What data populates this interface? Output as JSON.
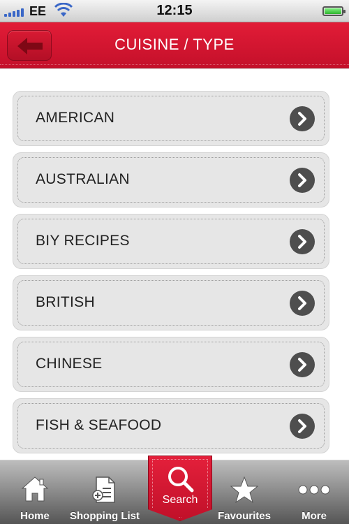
{
  "status_bar": {
    "carrier": "EE",
    "time": "12:15",
    "battery_level": 1.0,
    "signal_bars": 5,
    "icons": [
      "signal-icon",
      "wifi-icon",
      "battery-icon"
    ]
  },
  "nav": {
    "title": "CUISINE / TYPE",
    "back_icon": "back-arrow-icon"
  },
  "colors": {
    "brand_red": "#d8152f",
    "list_bg": "#e6e6e6",
    "chevron_bg": "#4e4e4e"
  },
  "list": {
    "items": [
      {
        "label": "AMERICAN"
      },
      {
        "label": "AUSTRALIAN"
      },
      {
        "label": "BIY RECIPES"
      },
      {
        "label": "BRITISH"
      },
      {
        "label": "CHINESE"
      },
      {
        "label": "FISH & SEAFOOD"
      }
    ]
  },
  "tab_bar": {
    "tabs": [
      {
        "label": "Home",
        "icon": "home-icon"
      },
      {
        "label": "Shopping List",
        "icon": "shopping-list-icon"
      },
      {
        "label": "Search",
        "icon": "search-icon",
        "selected": true
      },
      {
        "label": "Favourites",
        "icon": "star-icon"
      },
      {
        "label": "More",
        "icon": "more-icon"
      }
    ]
  }
}
